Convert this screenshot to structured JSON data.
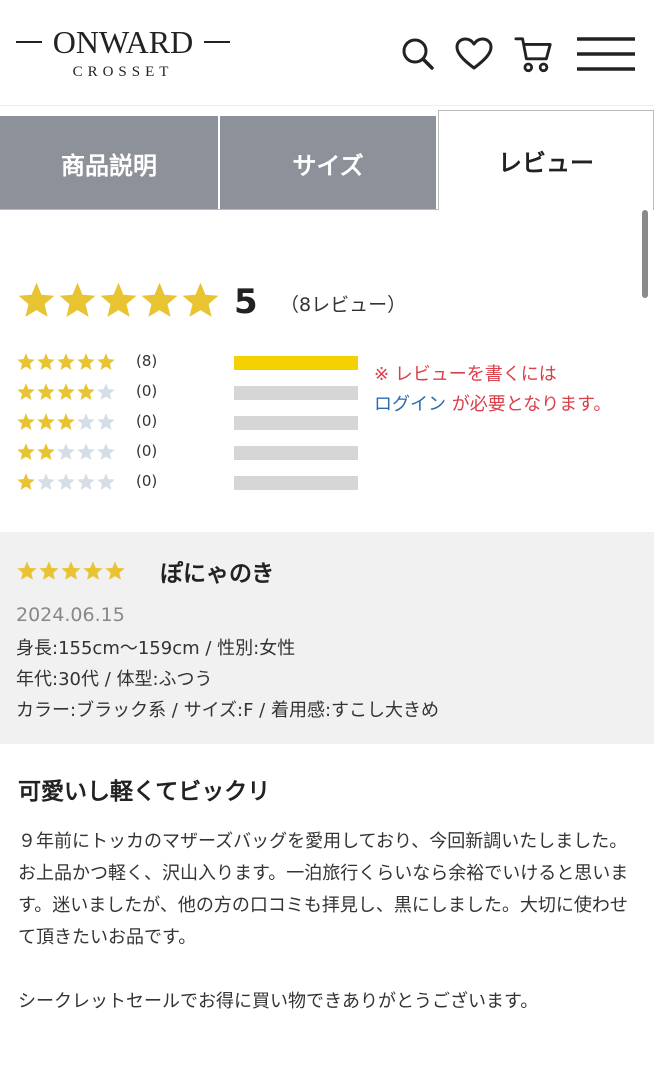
{
  "brand": {
    "name": "ONWARD",
    "sub": "CROSSET"
  },
  "header": {
    "icons": [
      "search-icon",
      "heart-icon",
      "cart-icon",
      "menu-icon"
    ]
  },
  "tabs": [
    {
      "label": "商品説明",
      "active": false
    },
    {
      "label": "サイズ",
      "active": false
    },
    {
      "label": "レビュー",
      "active": true
    }
  ],
  "summary": {
    "average": "5",
    "stars": 5,
    "count_text": "（8レビュー）",
    "distribution": [
      {
        "stars": 5,
        "count": "(8)",
        "fraction": 1.0
      },
      {
        "stars": 4,
        "count": "(0)",
        "fraction": 0.0
      },
      {
        "stars": 3,
        "count": "(0)",
        "fraction": 0.0
      },
      {
        "stars": 2,
        "count": "(0)",
        "fraction": 0.0
      },
      {
        "stars": 1,
        "count": "(0)",
        "fraction": 0.0
      }
    ]
  },
  "notice": {
    "line1": "※ レビューを書くには",
    "login": "ログイン",
    "line2": " が必要となります。"
  },
  "review": {
    "stars": 5,
    "reviewer": "ぽにゃのき",
    "date": "2024.06.15",
    "meta": [
      "身長:155cm〜159cm / 性別:女性",
      "年代:30代 / 体型:ふつう",
      "カラー:ブラック系 / サイズ:F / 着用感:すこし大きめ"
    ],
    "title": "可愛いし軽くてビックリ",
    "body": "９年前にトッカのマザーズバッグを愛用しており、今回新調いたしました。お上品かつ軽く、沢山入ります。一泊旅行くらいなら余裕でいけると思います。迷いましたが、他の方の口コミも拝見し、黒にしました。大切に使わせて頂きたいお品です。",
    "thanks": "シークレットセールでお得に買い物できありがとうございます。"
  },
  "colors": {
    "star_gold": "#e8c332",
    "star_empty": "#d5dde6",
    "tab_inactive": "#8d9199",
    "bar_fill": "#f5d000",
    "bar_empty": "#d6d6d6",
    "notice_red": "#d9404a",
    "link_blue": "#2b6cb0"
  }
}
